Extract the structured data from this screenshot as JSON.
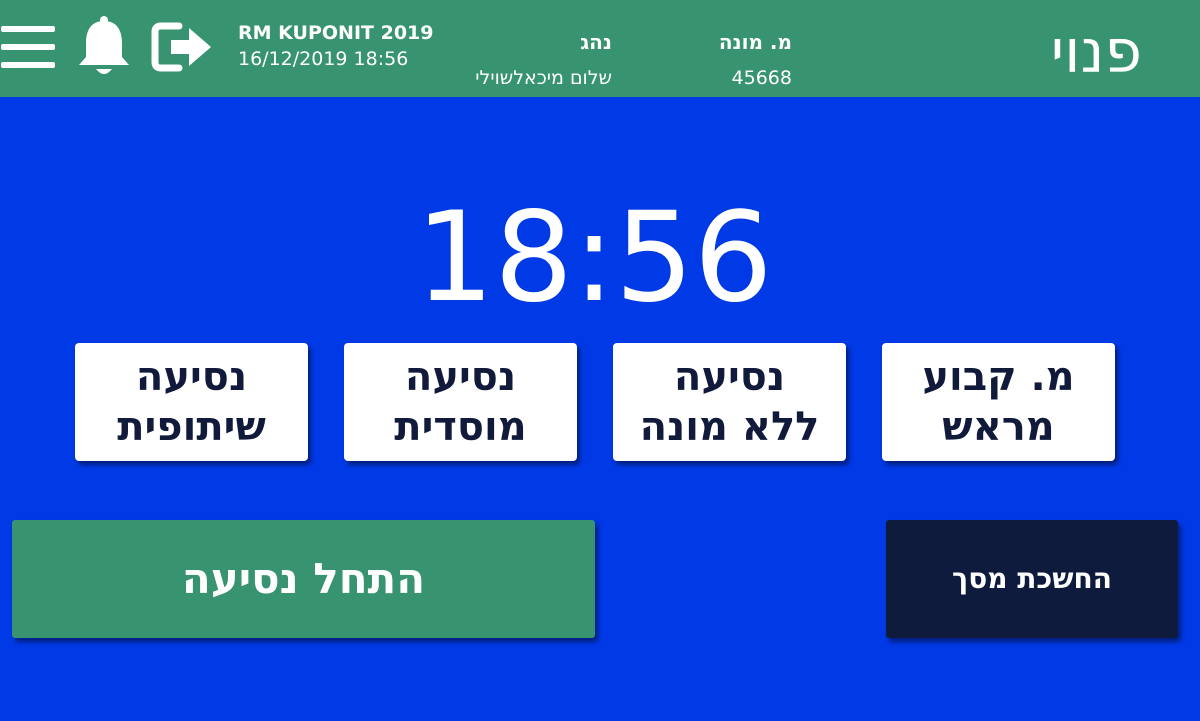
{
  "header": {
    "app_name": "RM KUPONIT 2019",
    "datetime": "16/12/2019 18:56",
    "driver_label": "נהג",
    "driver_name": "שלום מיכאלשוילי",
    "meter_label": "מ. מונה",
    "meter_number": "45668",
    "status": "פנוי",
    "icons": [
      "menu-icon",
      "bell-icon",
      "exit-icon"
    ]
  },
  "clock": "18:56",
  "trip_types": [
    {
      "line1": "נסיעה",
      "line2": "שיתופית"
    },
    {
      "line1": "נסיעה",
      "line2": "מוסדית"
    },
    {
      "line1": "נסיעה",
      "line2": "ללא מונה"
    },
    {
      "line1": "מ. קבוע",
      "line2": "מראש"
    }
  ],
  "actions": {
    "start_trip": "התחל נסיעה",
    "dim_screen": "החשכת מסך"
  },
  "colors": {
    "background": "#0039e6",
    "header": "#379370",
    "start_button": "#379370",
    "dim_button": "#0f1b3d",
    "trip_button_text": "#111a3a"
  }
}
